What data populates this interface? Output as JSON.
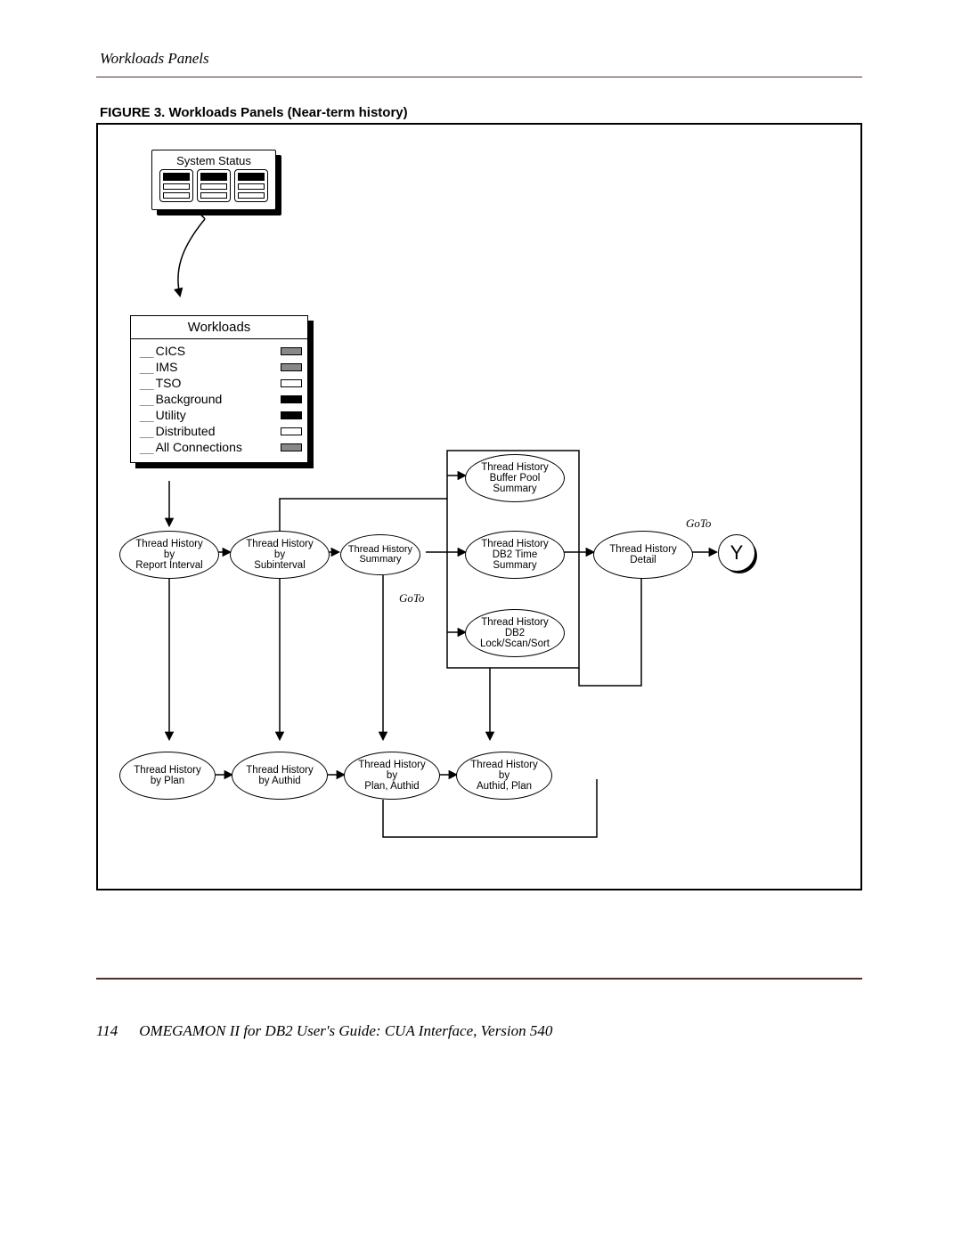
{
  "page": {
    "section_title": "Workloads Panels",
    "figure_label": "FIGURE 3.  Workloads Panels (Near-term history)",
    "page_number": "114",
    "footer_title": "OMEGAMON II for DB2 User's Guide: CUA Interface, Version 540"
  },
  "diagram": {
    "system_status_title": "System Status",
    "workloads_title": "Workloads",
    "workloads_items": [
      {
        "name": "CICS",
        "fill": "gray"
      },
      {
        "name": "IMS",
        "fill": "gray"
      },
      {
        "name": "TSO",
        "fill": "none"
      },
      {
        "name": "Background",
        "fill": "black"
      },
      {
        "name": "Utility",
        "fill": "black"
      },
      {
        "name": "Distributed",
        "fill": "none"
      },
      {
        "name": "All Connections",
        "fill": "gray"
      }
    ],
    "goto_label": "GoTo",
    "nodes": {
      "th_report_interval": {
        "l1": "Thread History",
        "l2": "by",
        "l3": "Report Interval"
      },
      "th_subinterval": {
        "l1": "Thread History",
        "l2": "by",
        "l3": "Subinterval"
      },
      "th_summary": {
        "l1": "Thread History",
        "l2": "Summary"
      },
      "th_buffer_pool": {
        "l1": "Thread History",
        "l2": "Buffer Pool",
        "l3": "Summary"
      },
      "th_db2_time": {
        "l1": "Thread History",
        "l2": "DB2 Time",
        "l3": "Summary"
      },
      "th_lock_scan_sort": {
        "l1": "Thread History",
        "l2": "DB2",
        "l3": "Lock/Scan/Sort"
      },
      "th_detail": {
        "l1": "Thread History",
        "l2": "Detail"
      },
      "y": "Y",
      "th_by_plan": {
        "l1": "Thread History",
        "l2": "by Plan"
      },
      "th_by_authid": {
        "l1": "Thread History",
        "l2": "by Authid"
      },
      "th_by_plan_authid": {
        "l1": "Thread History",
        "l2": "by",
        "l3": "Plan, Authid"
      },
      "th_by_authid_plan": {
        "l1": "Thread History",
        "l2": "by",
        "l3": "Authid, Plan"
      }
    }
  }
}
